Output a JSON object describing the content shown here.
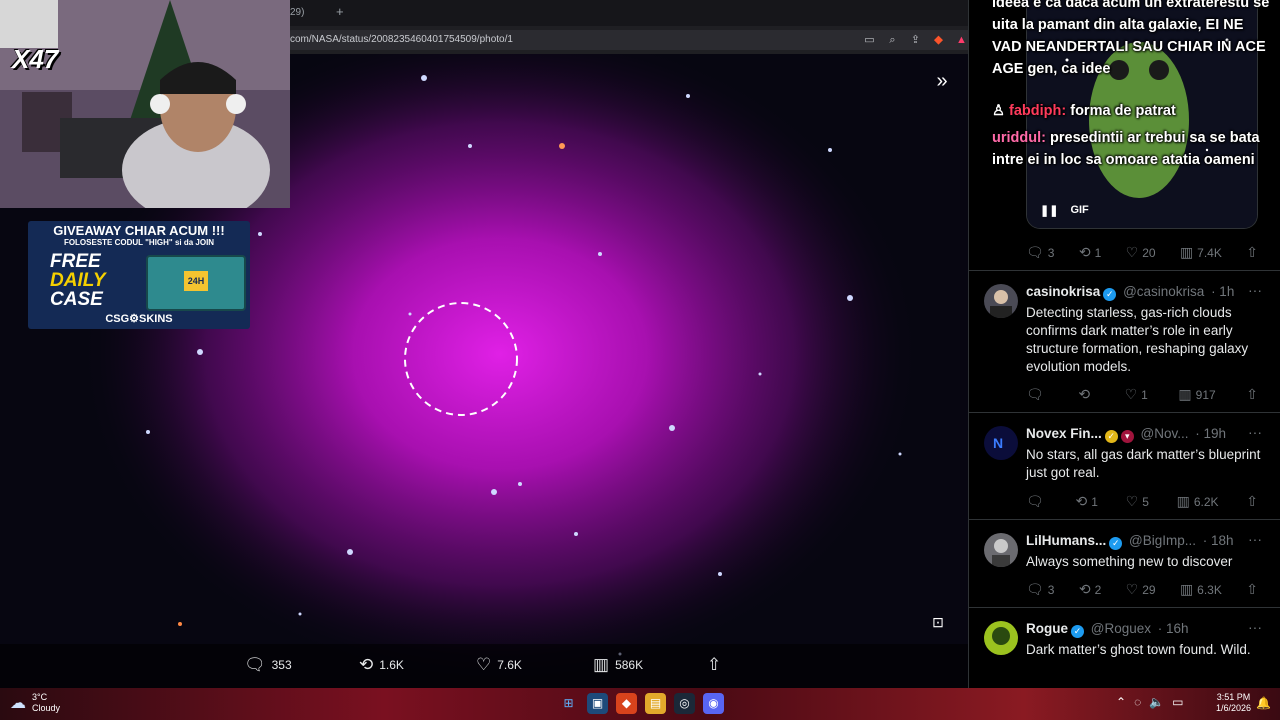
{
  "browser": {
    "tab_title": "29)",
    "new_tab": "+",
    "url": "com/NASA/status/2008235460401754509/photo/1"
  },
  "viewer": {
    "metrics": {
      "replies": "353",
      "reposts": "1.6K",
      "likes": "7.6K",
      "views": "586K"
    }
  },
  "stream_overlay": {
    "multiplier": "X47",
    "promo": {
      "line1": "GIVEAWAY CHIAR ACUM !!!",
      "line2": "FOLOSESTE CODUL \"HIGH\" si da JOIN",
      "big1": "FREE",
      "big2": "DAILY",
      "big3": "CASE",
      "crate_tag": "24H",
      "brand": "CSG⚙SKINS"
    },
    "chat": {
      "msg0_text": "ideea e ca daca acum un extraterestu se uita la pamant din alta galaxie, EI NE VAD NEANDERTALI SAU CHIAR IN ACE AGE gen, ca idee",
      "msg1_user": "fabdiph:",
      "msg1_text": "forma de patrat",
      "msg2_user": "uriddul:",
      "msg2_text": "presedintii ar trebui sa se bata intre ei in loc sa omoare atatia oameni"
    }
  },
  "sidebar": {
    "gif": {
      "pause": "❚❚",
      "label": "GIF"
    },
    "top_metrics": {
      "replies": "3",
      "reposts": "1",
      "likes": "20",
      "views": "7.4K"
    },
    "tweets": [
      {
        "name": "casinokrisa",
        "handle": "@casinokrisa",
        "time": "· 1h",
        "text": "Detecting starless, gas-rich clouds confirms dark matter’s role in early structure formation, reshaping galaxy evolution models.",
        "replies": "",
        "reposts": "",
        "likes": "1",
        "views": "917"
      },
      {
        "name": "Novex Fin...",
        "handle": "@Nov...",
        "time": "· 19h",
        "text": "No stars, all gas dark matter’s blueprint just got real.",
        "replies": "",
        "reposts": "1",
        "likes": "5",
        "views": "6.2K"
      },
      {
        "name": "LilHumans...",
        "handle": "@BigImp...",
        "time": "· 18h",
        "text": "Always something new to discover",
        "replies": "3",
        "reposts": "2",
        "likes": "29",
        "views": "6.3K"
      },
      {
        "name": "Rogue",
        "handle": "@Roguex",
        "time": "· 16h",
        "text": "Dark matter’s ghost town found. Wild.",
        "replies": "",
        "reposts": "",
        "likes": "",
        "views": ""
      }
    ]
  },
  "taskbar": {
    "temp": "3°C",
    "weather": "Cloudy",
    "time": "3:51 PM",
    "date": "1/6/2026"
  }
}
